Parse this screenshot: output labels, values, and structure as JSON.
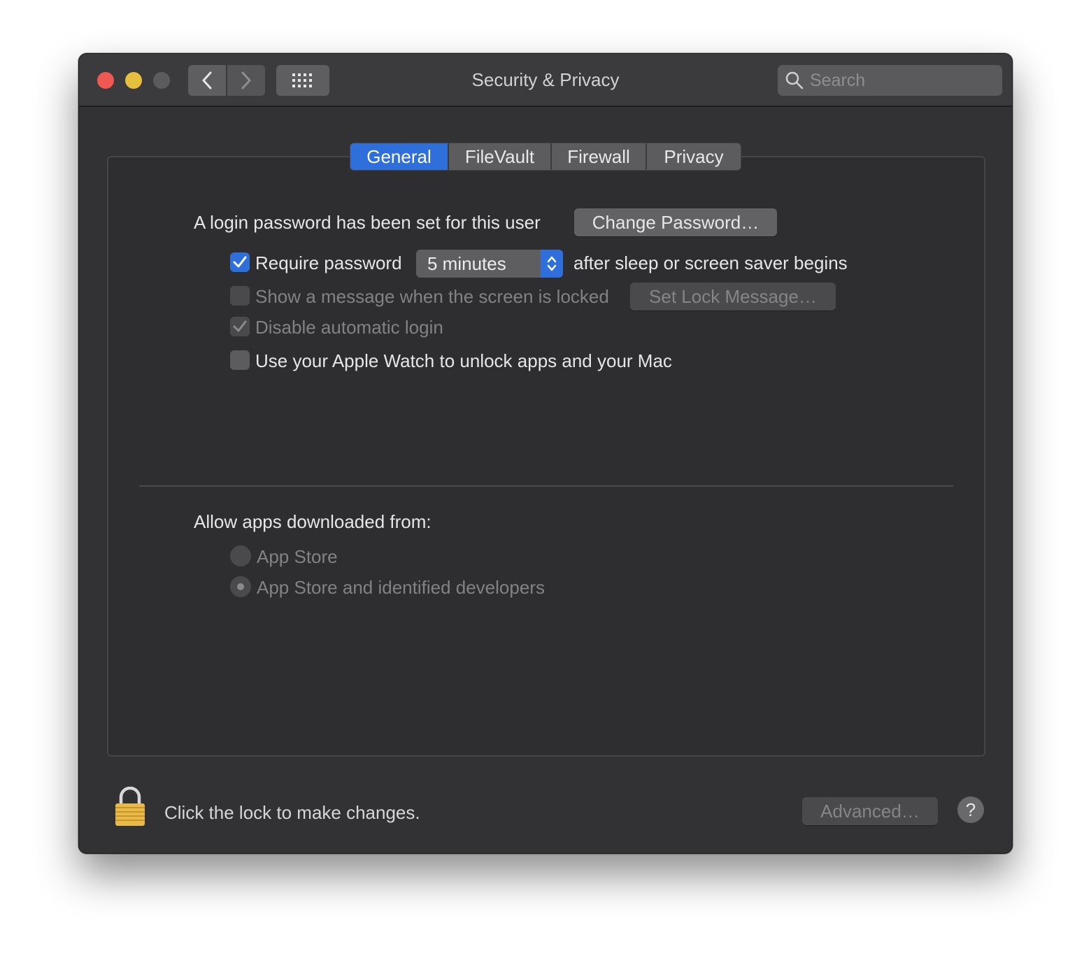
{
  "window": {
    "title": "Security & Privacy",
    "search": {
      "placeholder": "Search",
      "value": ""
    }
  },
  "tabs": [
    {
      "label": "General",
      "active": true
    },
    {
      "label": "FileVault",
      "active": false
    },
    {
      "label": "Firewall",
      "active": false
    },
    {
      "label": "Privacy",
      "active": false
    }
  ],
  "general": {
    "login_password_text": "A login password has been set for this user",
    "change_password_label": "Change Password…",
    "require_password": {
      "label": "Require password",
      "checked": true,
      "select_value": "5 minutes",
      "suffix": "after sleep or screen saver begins"
    },
    "show_message": {
      "label": "Show a message when the screen is locked",
      "checked": false,
      "enabled": false,
      "button_label": "Set Lock Message…"
    },
    "disable_auto_login": {
      "label": "Disable automatic login",
      "checked": true,
      "enabled": false
    },
    "apple_watch": {
      "label": "Use your Apple Watch to unlock apps and your Mac",
      "checked": false
    },
    "allow_apps_heading": "Allow apps downloaded from:",
    "allow_apps_options": [
      {
        "label": "App Store",
        "selected": false
      },
      {
        "label": "App Store and identified developers",
        "selected": true
      }
    ]
  },
  "footer": {
    "lock_text": "Click the lock to make changes.",
    "advanced_label": "Advanced…",
    "help_label": "?"
  },
  "colors": {
    "accent": "#2f6fdc",
    "close": "#ee5a52",
    "minimize": "#e7bf3e",
    "lock": "#e9b949"
  }
}
